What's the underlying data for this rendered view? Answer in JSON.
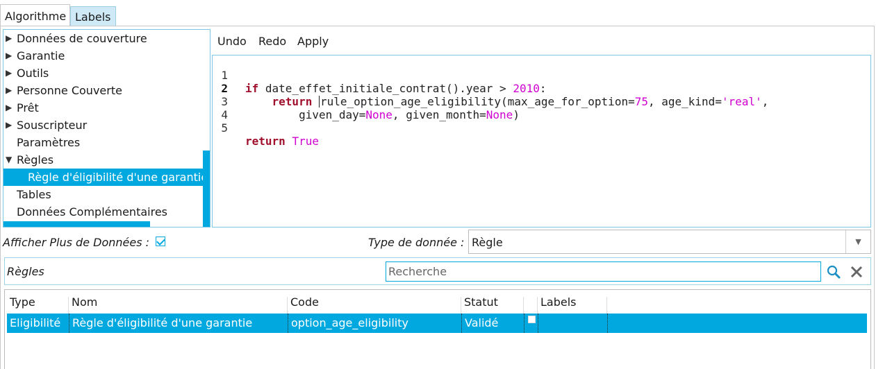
{
  "tabs": [
    {
      "label": "Algorithme",
      "active": true
    },
    {
      "label": "Labels",
      "active": false
    }
  ],
  "tree": {
    "items": [
      {
        "label": "Données de couverture",
        "expander": "▶"
      },
      {
        "label": "Garantie",
        "expander": "▶"
      },
      {
        "label": "Outils",
        "expander": "▶"
      },
      {
        "label": "Personne Couverte",
        "expander": "▶"
      },
      {
        "label": "Prêt",
        "expander": "▶"
      },
      {
        "label": "Souscripteur",
        "expander": "▶"
      },
      {
        "label": "Paramètres",
        "expander": ""
      },
      {
        "label": "Règles",
        "expander": "▼"
      },
      {
        "label": "Règle d'éligibilité d'une garantie",
        "expander": "",
        "selected": true,
        "child": true
      },
      {
        "label": "Tables",
        "expander": ""
      },
      {
        "label": "Données Complémentaires",
        "expander": ""
      }
    ]
  },
  "editor": {
    "toolbar": {
      "undo": "Undo",
      "redo": "Redo",
      "apply": "Apply"
    },
    "line_numbers": [
      "1",
      "2",
      "3",
      "4",
      "5"
    ],
    "active_line": 2
  },
  "options": {
    "more_data_label": "Afficher Plus de Données :",
    "more_data_checked": true,
    "data_type_label": "Type de donnée :",
    "data_type_value": "Règle"
  },
  "search": {
    "section_label": "Règles",
    "placeholder": "Recherche",
    "value": ""
  },
  "table": {
    "columns": [
      "Type",
      "Nom",
      "Code",
      "Statut",
      "",
      "Labels"
    ],
    "rows": [
      {
        "type": "Eligibilité",
        "nom": "Règle d'éligibilité d'une garantie",
        "code": "option_age_eligibility",
        "statut": "Validé",
        "checked": false,
        "labels": "",
        "selected": true
      }
    ]
  },
  "colors": {
    "accent": "#00a8e0",
    "keyword": "#a0102c",
    "literal": "#d000d0",
    "tab_inactive": "#cfe9f7"
  }
}
